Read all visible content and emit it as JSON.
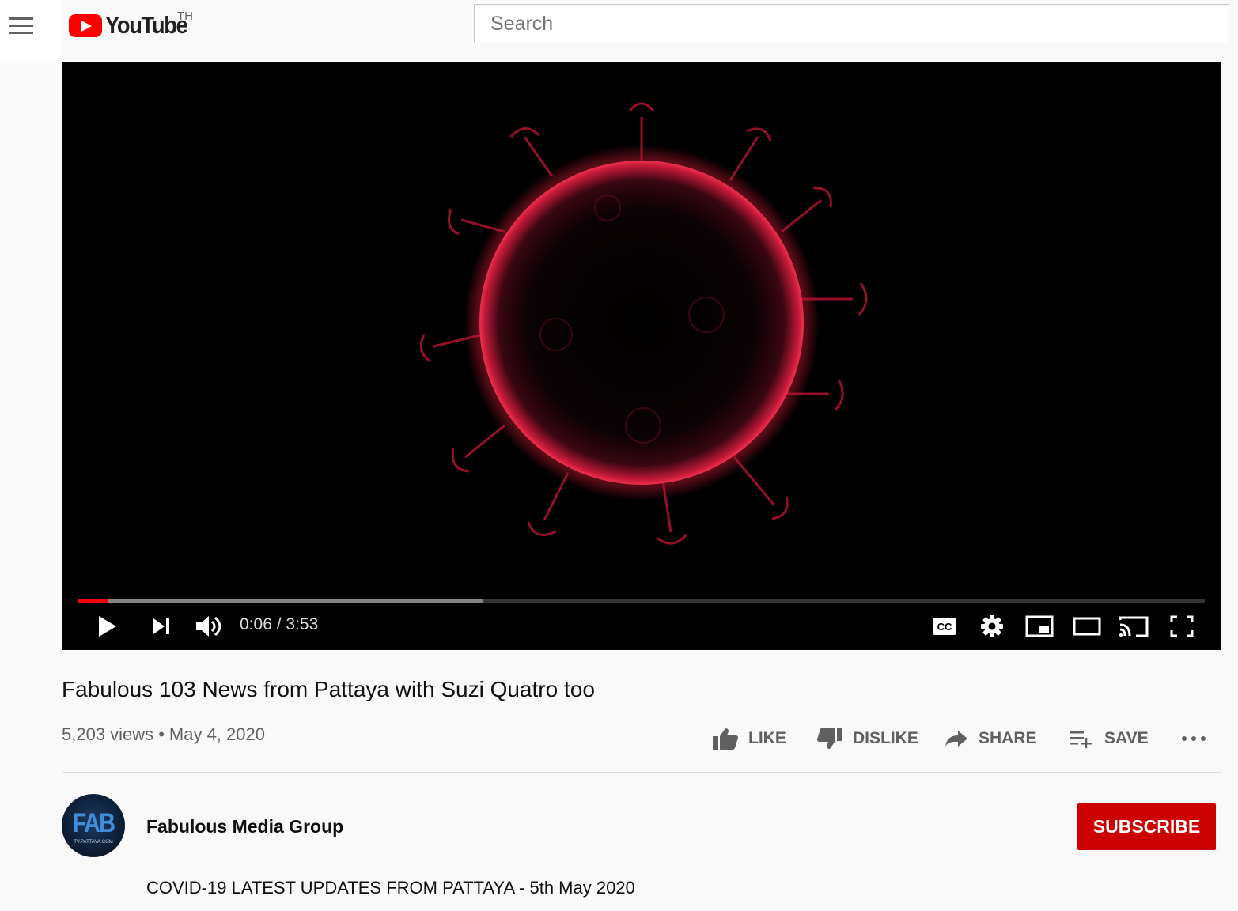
{
  "masthead": {
    "logo_text": "YouTube",
    "country_code": "TH",
    "search_placeholder": "Search"
  },
  "player": {
    "current_time": "0:06",
    "duration": "3:53",
    "time_display": "0:06 / 3:53",
    "progress_played_fraction": 0.027,
    "progress_buffered_fraction": 0.36,
    "accent_color": "#ff0000"
  },
  "video": {
    "title": "Fabulous 103 News from Pattaya with Suzi Quatro too",
    "views": "5,203 views",
    "separator": "•",
    "date": "May 4, 2020"
  },
  "actions": {
    "like_label": "LIKE",
    "dislike_label": "DISLIKE",
    "share_label": "SHARE",
    "save_label": "SAVE"
  },
  "channel": {
    "name": "Fabulous Media Group",
    "avatar_text": "FAB",
    "avatar_subtext": "TV.PATTAYA.COM",
    "subscribe_label": "SUBSCRIBE",
    "subscribe_color": "#cc0000"
  },
  "description": {
    "text": "COVID-19 LATEST UPDATES FROM PATTAYA - 5th May 2020"
  },
  "icons": [
    "menu-icon",
    "youtube-logo-icon",
    "play-icon",
    "next-icon",
    "volume-icon",
    "captions-icon",
    "settings-icon",
    "miniplayer-icon",
    "theater-mode-icon",
    "cast-icon",
    "fullscreen-icon",
    "like-icon",
    "dislike-icon",
    "share-icon",
    "save-icon",
    "more-icon"
  ]
}
